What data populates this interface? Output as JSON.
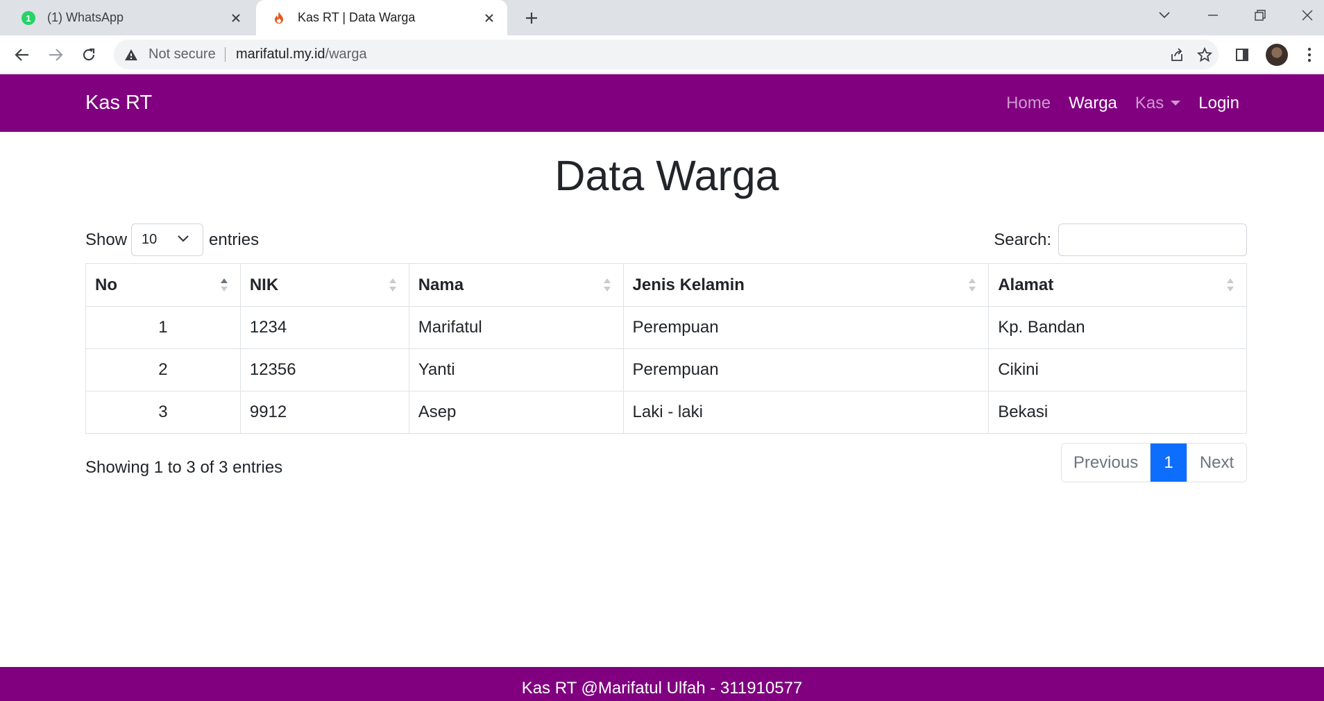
{
  "browser": {
    "tabs": [
      {
        "title": "(1) WhatsApp",
        "badge": "1"
      },
      {
        "title": "Kas RT | Data Warga"
      }
    ],
    "address": {
      "security": "Not secure",
      "host": "marifatul.my.id",
      "path": "/warga"
    },
    "icons": [
      "back-icon",
      "forward-icon",
      "reload-icon",
      "warning-icon",
      "share-icon",
      "star-icon",
      "side-panel-icon",
      "menu-dots-icon"
    ]
  },
  "navbar": {
    "brand": "Kas RT",
    "links": [
      {
        "label": "Home",
        "active": false
      },
      {
        "label": "Warga",
        "active": true
      },
      {
        "label": "Kas",
        "active": false,
        "dropdown": true
      },
      {
        "label": "Login",
        "active": true
      }
    ],
    "color": "#800080"
  },
  "page": {
    "title": "Data Warga",
    "length": {
      "show": "Show",
      "value": "10",
      "entries": "entries"
    },
    "search": {
      "label": "Search:",
      "value": ""
    },
    "table": {
      "columns": [
        "No",
        "NIK",
        "Nama",
        "Jenis Kelamin",
        "Alamat"
      ],
      "rows": [
        [
          "1",
          "1234",
          "Marifatul",
          "Perempuan",
          "Kp. Bandan"
        ],
        [
          "2",
          "12356",
          "Yanti",
          "Perempuan",
          "Cikini"
        ],
        [
          "3",
          "9912",
          "Asep",
          "Laki - laki",
          "Bekasi"
        ]
      ]
    },
    "info": "Showing 1 to 3 of 3 entries",
    "pagination": {
      "previous": "Previous",
      "current": "1",
      "next": "Next"
    },
    "accent": "#0d6efd"
  },
  "footer": {
    "text": "Kas RT @Marifatul Ulfah - 311910577"
  }
}
